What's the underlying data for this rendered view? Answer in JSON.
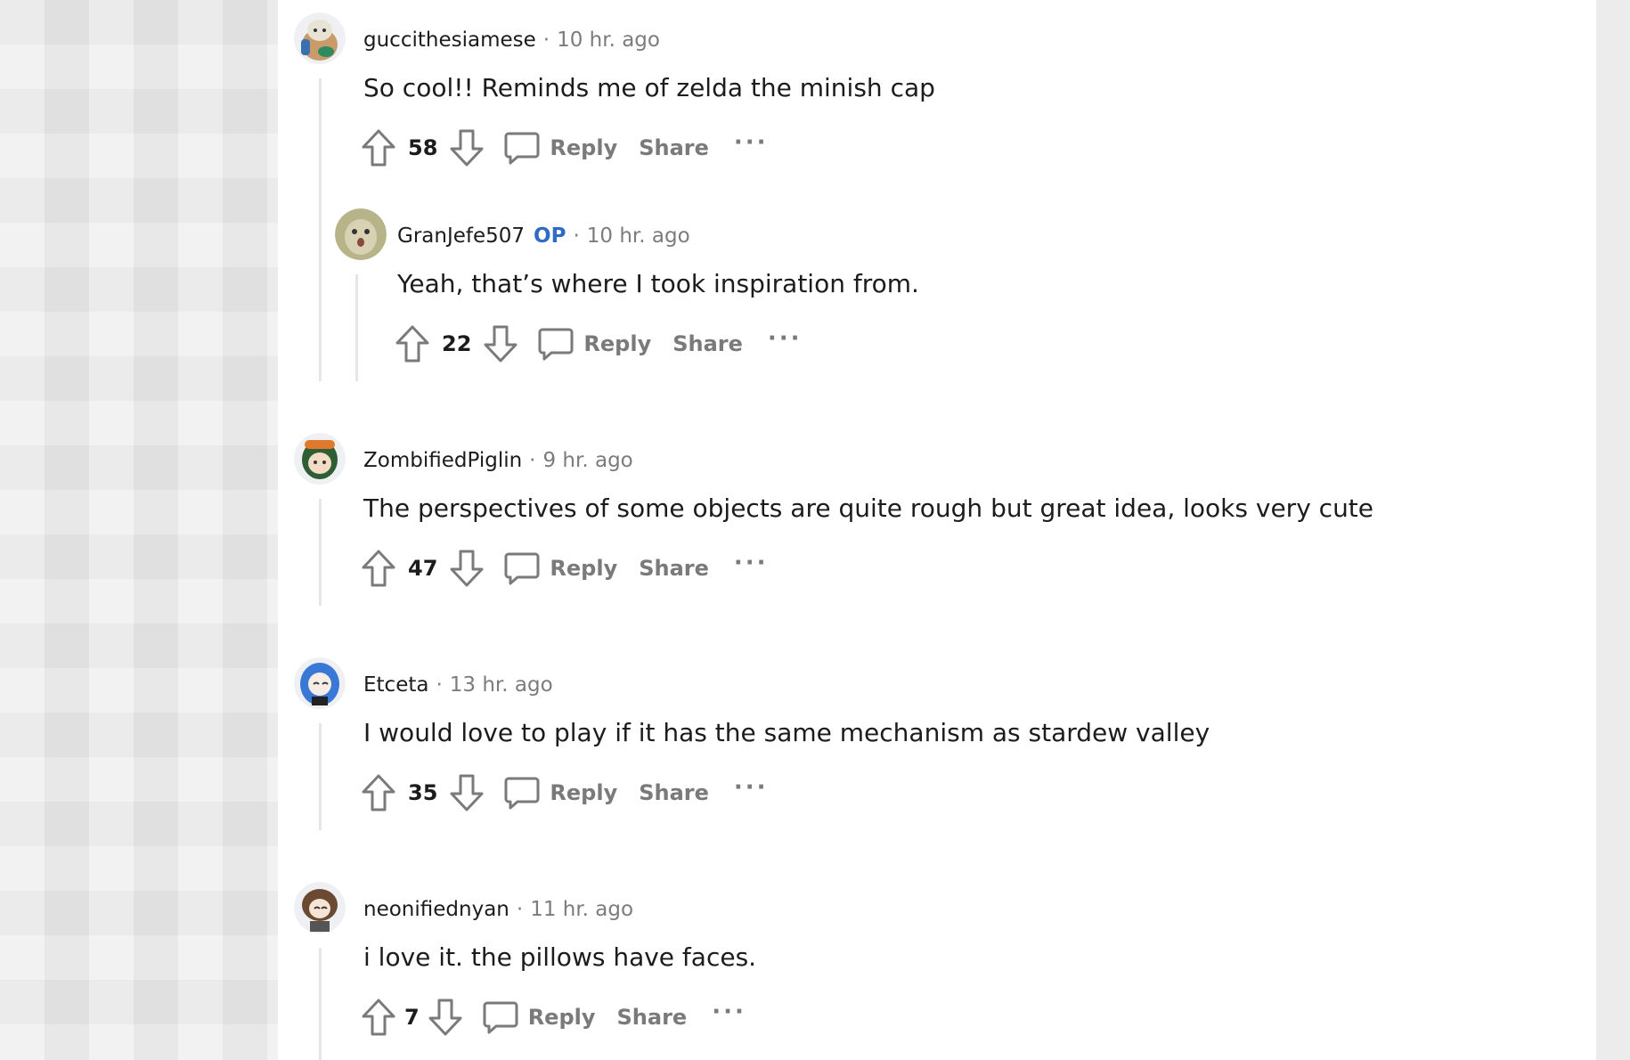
{
  "comments": [
    {
      "username": "guccithesiamese",
      "op": "",
      "time": "10 hr. ago",
      "text": "So cool!! Reminds me of zelda the minish cap",
      "votes": "58",
      "reply": "Reply",
      "share": "Share",
      "more": "···"
    },
    {
      "username": "GranJefe507",
      "op": "OP",
      "time": "10 hr. ago",
      "text": "Yeah, that’s where I took inspiration from.",
      "votes": "22",
      "reply": "Reply",
      "share": "Share",
      "more": "···"
    },
    {
      "username": "ZombifiedPiglin",
      "op": "",
      "time": "9 hr. ago",
      "text": "The perspectives of some objects are quite rough but great idea, looks very cute",
      "votes": "47",
      "reply": "Reply",
      "share": "Share",
      "more": "···"
    },
    {
      "username": "Etceta",
      "op": "",
      "time": "13 hr. ago",
      "text": "I would love to play if it has the same mechanism as stardew valley",
      "votes": "35",
      "reply": "Reply",
      "share": "Share",
      "more": "···"
    },
    {
      "username": "neonifiednyan",
      "op": "",
      "time": "11 hr. ago",
      "text": "i love it. the pillows have faces.",
      "votes": "7",
      "reply": "Reply",
      "share": "Share",
      "more": "···"
    }
  ],
  "separator": "·",
  "colors": {
    "op_badge": "#2f6bc4",
    "meta_gray": "#7c7c7c",
    "action_gray": "#7a7a7a",
    "text": "#1c1c1c",
    "thread_line": "#e6e6e6"
  }
}
